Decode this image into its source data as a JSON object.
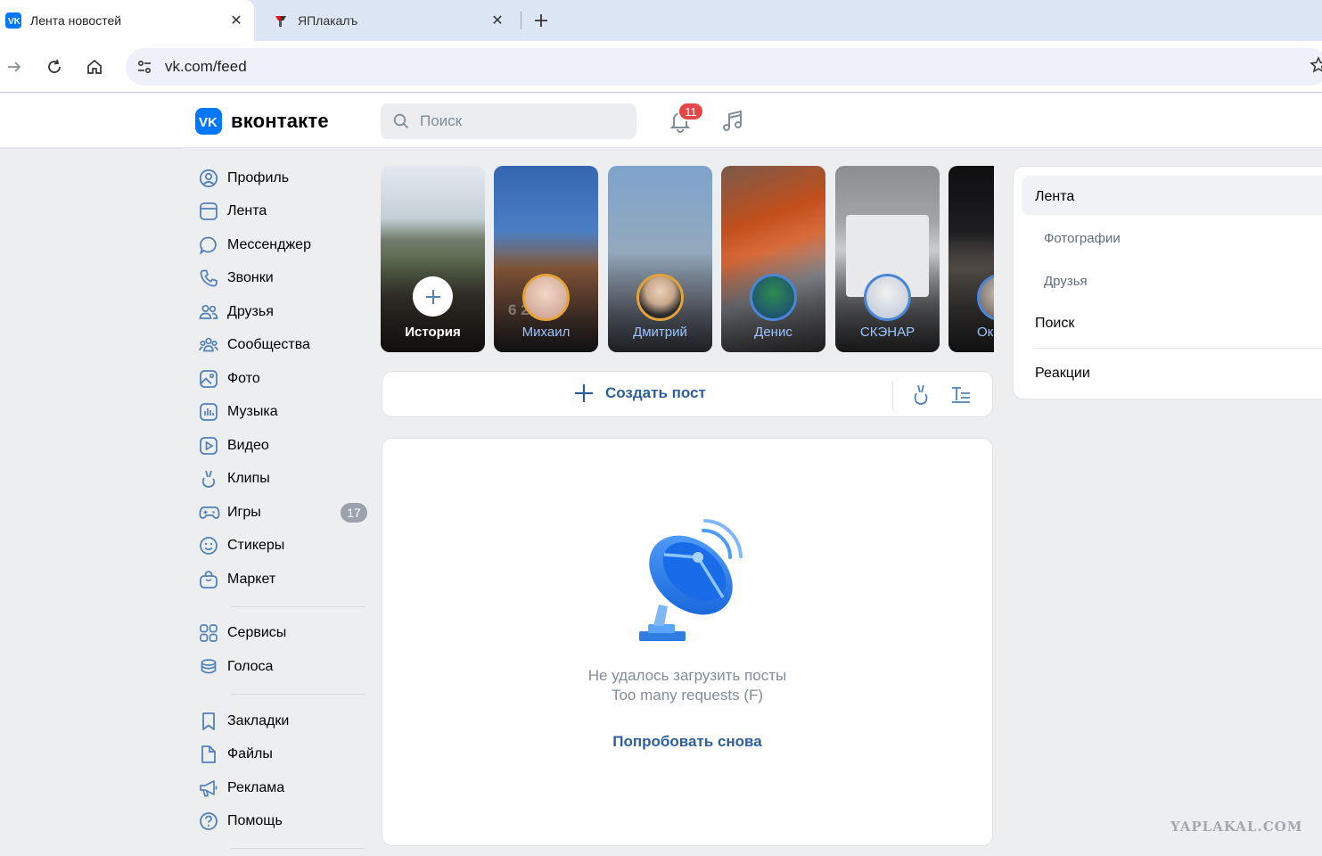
{
  "browser": {
    "tabs": [
      {
        "title": "Лента новостей",
        "active": true,
        "favicon": "vk-icon"
      },
      {
        "title": "ЯПлакалъ",
        "active": false,
        "favicon": "yaplakal-icon"
      }
    ],
    "url": "vk.com/feed"
  },
  "header": {
    "logo_text": "вконтакте",
    "search_placeholder": "Поиск",
    "notifications_count": "11"
  },
  "sidebar": {
    "items": [
      {
        "label": "Профиль",
        "icon": "user-circle-icon"
      },
      {
        "label": "Лента",
        "icon": "newsfeed-icon"
      },
      {
        "label": "Мессенджер",
        "icon": "message-icon"
      },
      {
        "label": "Звонки",
        "icon": "phone-icon"
      },
      {
        "label": "Друзья",
        "icon": "friends-icon"
      },
      {
        "label": "Сообщества",
        "icon": "communities-icon"
      },
      {
        "label": "Фото",
        "icon": "photo-icon"
      },
      {
        "label": "Музыка",
        "icon": "music-icon"
      },
      {
        "label": "Видео",
        "icon": "video-icon"
      },
      {
        "label": "Клипы",
        "icon": "clips-icon"
      },
      {
        "label": "Игры",
        "icon": "gamepad-icon",
        "count": "17"
      },
      {
        "label": "Стикеры",
        "icon": "smile-icon"
      },
      {
        "label": "Маркет",
        "icon": "market-bag-icon"
      },
      {
        "label": "Сервисы",
        "icon": "services-grid-icon"
      },
      {
        "label": "Голоса",
        "icon": "coins-icon"
      },
      {
        "label": "Закладки",
        "icon": "bookmark-icon"
      },
      {
        "label": "Файлы",
        "icon": "file-icon"
      },
      {
        "label": "Реклама",
        "icon": "megaphone-icon"
      },
      {
        "label": "Помощь",
        "icon": "help-icon"
      }
    ]
  },
  "stories": [
    {
      "name": "История",
      "type": "create"
    },
    {
      "name": "Михаил",
      "overlay": "6 2   18"
    },
    {
      "name": "Дмитрий"
    },
    {
      "name": "Денис"
    },
    {
      "name": "СКЭНАР"
    },
    {
      "name": "Ок"
    }
  ],
  "create_post": {
    "label": "Создать пост"
  },
  "feed_error": {
    "message": "Не удалось загрузить посты",
    "detail": "Too many requests (F)",
    "retry": "Попробовать снова"
  },
  "right_menu": {
    "items": [
      {
        "label": "Лента",
        "active": true
      },
      {
        "label": "Фотографии",
        "sub": true
      },
      {
        "label": "Друзья",
        "sub": true
      },
      {
        "label": "Поиск"
      },
      {
        "label": "Реакции"
      }
    ]
  },
  "watermark": "YAPLAKAL.COM",
  "colors": {
    "vk_blue": "#0077ff",
    "link_blue": "#2d5f99",
    "badge_red": "#e64646",
    "page_bg": "#edeef0"
  }
}
